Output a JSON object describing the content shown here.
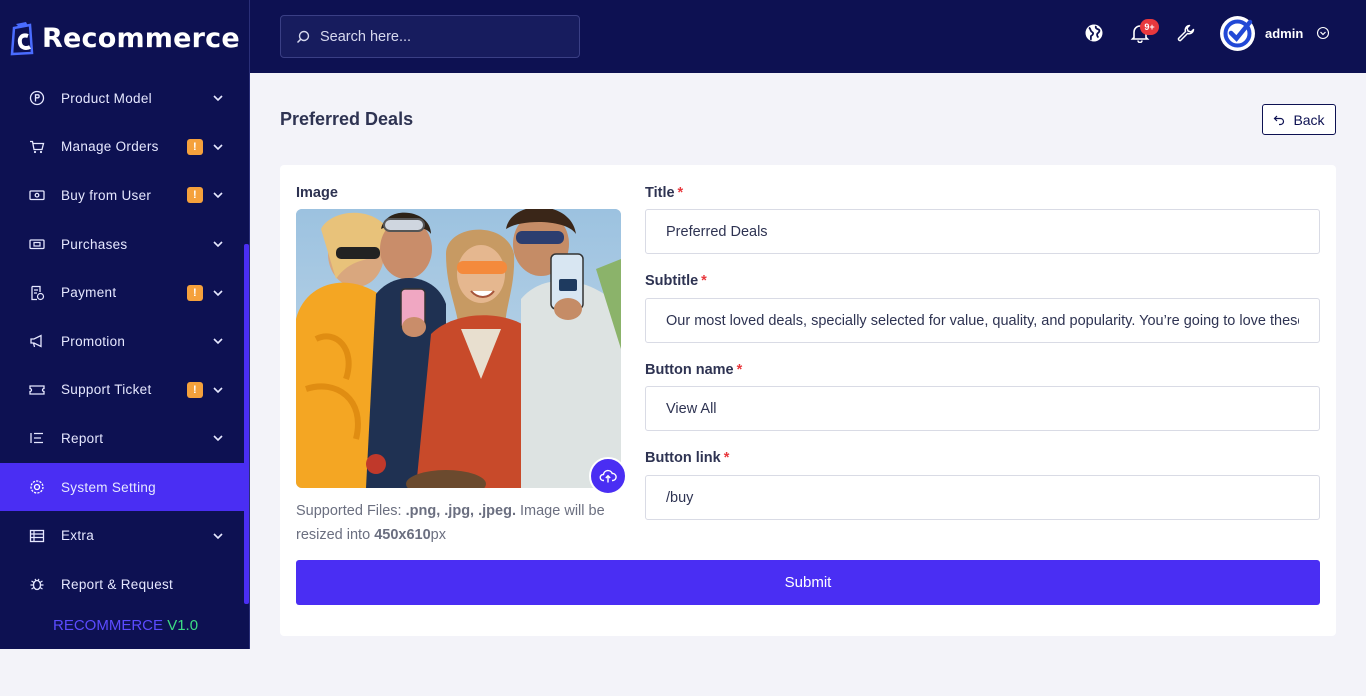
{
  "app": {
    "logo_text": "Recommerce",
    "version_brand": "RECOMMERCE",
    "version_number": "V1.0"
  },
  "sidebar": {
    "items": [
      {
        "label": "Product Model",
        "icon": "product-icon",
        "badge": "",
        "chevron": true
      },
      {
        "label": "Manage Orders",
        "icon": "cart-icon",
        "badge": "!",
        "chevron": true
      },
      {
        "label": "Buy from User",
        "icon": "cash-icon",
        "badge": "!",
        "chevron": true
      },
      {
        "label": "Purchases",
        "icon": "purchase-icon",
        "badge": "",
        "chevron": true
      },
      {
        "label": "Payment",
        "icon": "receipt-icon",
        "badge": "!",
        "chevron": true
      },
      {
        "label": "Promotion",
        "icon": "megaphone-icon",
        "badge": "",
        "chevron": true
      },
      {
        "label": "Support Ticket",
        "icon": "ticket-icon",
        "badge": "!",
        "chevron": true
      },
      {
        "label": "Report",
        "icon": "list-icon",
        "badge": "",
        "chevron": true
      },
      {
        "label": "System Setting",
        "icon": "gear-icon",
        "badge": "",
        "chevron": false,
        "active": true
      },
      {
        "label": "Extra",
        "icon": "grid-icon",
        "badge": "",
        "chevron": true
      },
      {
        "label": "Report & Request",
        "icon": "bug-icon",
        "badge": "",
        "chevron": false
      }
    ]
  },
  "header": {
    "search_placeholder": "Search here...",
    "notification_count": "9+",
    "user_name": "admin"
  },
  "page": {
    "title": "Preferred Deals",
    "back_label": "Back"
  },
  "form": {
    "image_label": "Image",
    "note_prefix": "Supported Files: ",
    "note_types": ".png, .jpg, .jpeg.",
    "note_middle": " Image will be resized into ",
    "note_size": "450x610",
    "note_suffix": "px",
    "title_label": "Title",
    "title_value": "Preferred Deals",
    "subtitle_label": "Subtitle",
    "subtitle_value": "Our most loved deals, specially selected for value, quality, and popularity. You’re going to love these.",
    "button_name_label": "Button name",
    "button_name_value": "View All",
    "button_link_label": "Button link",
    "button_link_value": "/buy",
    "required_mark": "*",
    "submit_label": "Submit"
  },
  "colors": {
    "sidebar_bg": "#0d1152",
    "accent": "#4a2ef3",
    "badge": "#f5a13c",
    "danger": "#e8383d",
    "page_bg": "#f3f3f9"
  }
}
